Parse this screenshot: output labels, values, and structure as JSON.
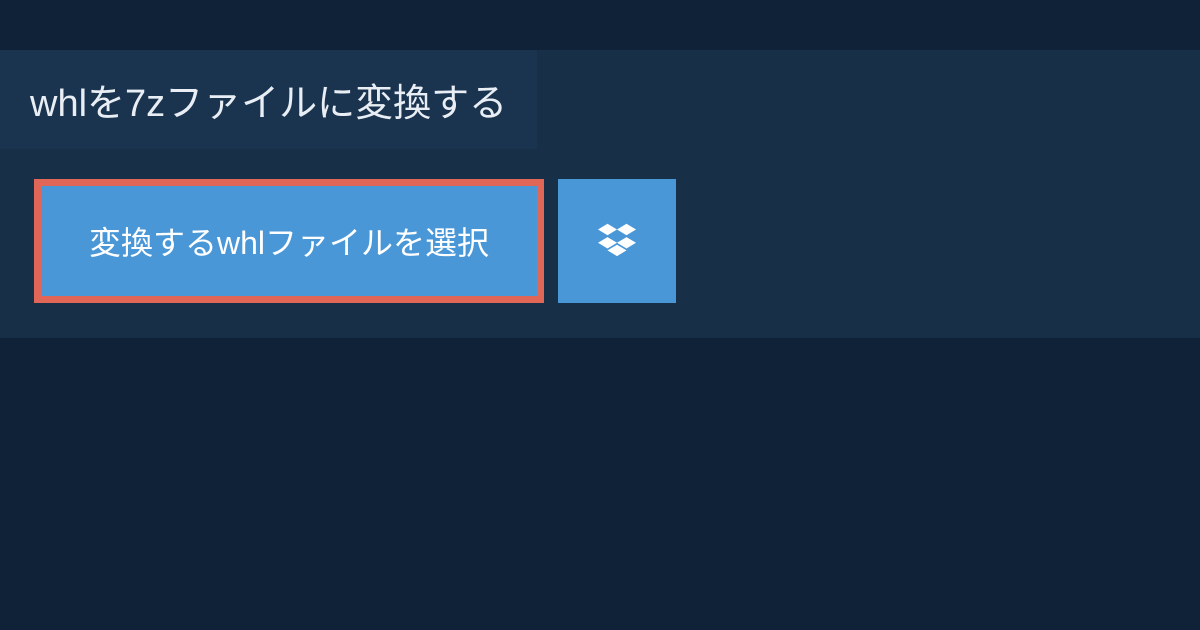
{
  "header": {
    "title": "whlを7zファイルに変換する"
  },
  "actions": {
    "select_file_label": "変換するwhlファイルを選択"
  }
}
